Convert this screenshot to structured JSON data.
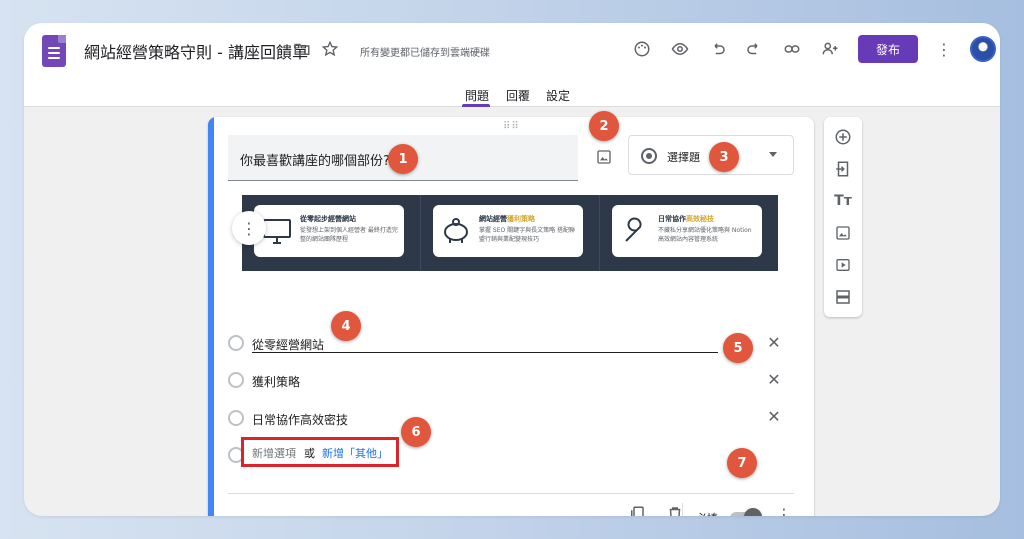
{
  "app": {
    "doc_title": "網站經營策略守則 - 講座回饋單",
    "save_status": "所有變更都已儲存到雲端硬碟",
    "publish_label": "發布",
    "tabs": [
      "問題",
      "回覆",
      "設定"
    ],
    "active_tab": "問題",
    "accent_color": "#673ab7"
  },
  "question": {
    "title": "你最喜歡講座的哪個部份?",
    "type_label": "選擇題",
    "options": [
      {
        "label": "從零經營網站"
      },
      {
        "label": "獲利策略"
      },
      {
        "label": "日常協作高效密技"
      }
    ],
    "add_option_label": "新增選項",
    "or_label": "或",
    "add_other_label": "新增「其他」",
    "required_label": "必填",
    "required": true
  },
  "banner": {
    "items": [
      {
        "title_pre": "從零起步",
        "title_hl": "",
        "title_post": "經營網站",
        "desc": "從發想上架到個人經營者 最終打造完整的網站團隊歷程",
        "icon": "monitor-icon"
      },
      {
        "title_pre": "網站經營",
        "title_hl": "獲利策略",
        "title_post": "",
        "desc": "掌握 SEO 關鍵字與長文策略 搭配聯盟行銷與業配變現技巧",
        "icon": "piggy-bank-icon"
      },
      {
        "title_pre": "日常協作",
        "title_hl": "高效秘技",
        "title_post": "",
        "desc": "不藏私分享網站優化策略與 Notion 高效網站內容管理系統",
        "icon": "wrench-icon"
      }
    ]
  },
  "badges": [
    "1",
    "2",
    "3",
    "4",
    "5",
    "6",
    "7"
  ],
  "colors": {
    "badge": "#e0573d",
    "highlight_box": "#d9252b",
    "card_accent": "#4285f4"
  }
}
